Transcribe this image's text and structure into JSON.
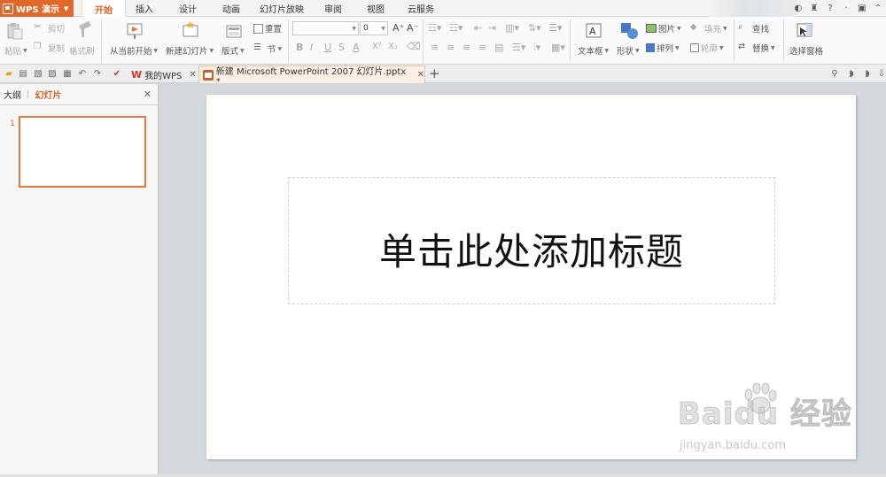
{
  "app": {
    "name": "WPS 演示",
    "tabs": [
      "开始",
      "插入",
      "设计",
      "动画",
      "幻灯片放映",
      "审阅",
      "视图",
      "云服务"
    ],
    "active_tab": "开始"
  },
  "ribbon": {
    "paste": "粘贴",
    "cut": "剪切",
    "copy": "复制",
    "format_painter": "格式刷",
    "from_current": "从当前开始",
    "new_slide": "新建幻灯片",
    "layout": "版式",
    "reset": "重置",
    "section": "节",
    "font_name": "",
    "font_size": "0",
    "bold": "B",
    "italic": "I",
    "underline": "U",
    "strike": "S",
    "font_color": "A",
    "superscript": "X²",
    "subscript": "X₂",
    "grow": "A⁺",
    "shrink": "A⁻",
    "textbox": "文本框",
    "shape": "形状",
    "picture": "图片",
    "arrange": "排列",
    "fill": "填充",
    "outline": "轮廓",
    "find": "查找",
    "replace": "替换",
    "selection_pane": "选择窗格"
  },
  "doc_tabs": [
    {
      "label": "我的WPS",
      "logo": "W"
    },
    {
      "label": "新建 Microsoft PowerPoint 2007 幻灯片.pptx *"
    }
  ],
  "left_panel": {
    "tab_outline": "大纲",
    "tab_slides": "幻灯片",
    "slide_number": "1"
  },
  "slide": {
    "title_placeholder": "单击此处添加标题"
  },
  "watermark": {
    "brand": "Baidu 经验",
    "url": "jingyan.baidu.com"
  },
  "colors": {
    "accent": "#e2672a",
    "active_tab_text": "#d96524",
    "thumb_border": "#e07a3c"
  }
}
